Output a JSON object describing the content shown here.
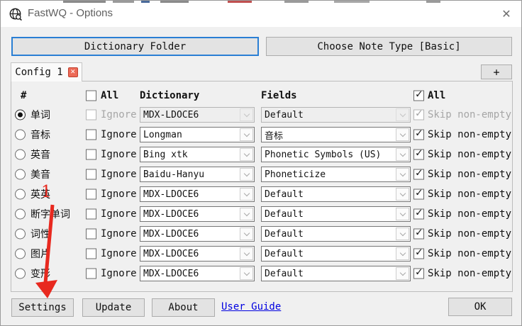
{
  "window": {
    "title": "FastWQ - Options",
    "close_glyph": "✕"
  },
  "toolbar": {
    "dictionary_folder": "Dictionary Folder",
    "choose_note_type": "Choose Note Type [Basic]"
  },
  "tabs": {
    "active_label": "Config 1",
    "close_glyph": "✕",
    "add_label": "+"
  },
  "table": {
    "headers": {
      "number": "#",
      "all_left": "All",
      "dictionary": "Dictionary",
      "fields": "Fields",
      "all_right": "All"
    },
    "ignore_label": "Ignore",
    "skip_label": "Skip non-empty",
    "rows": [
      {
        "label": "单词",
        "selected": true,
        "disabled": true,
        "dictionary": "MDX-LDOCE6",
        "field": "Default",
        "skip_checked": true
      },
      {
        "label": "音标",
        "selected": false,
        "disabled": false,
        "dictionary": "Longman",
        "field": "音标",
        "skip_checked": true
      },
      {
        "label": "英音",
        "selected": false,
        "disabled": false,
        "dictionary": "Bing xtk",
        "field": "Phonetic Symbols (US)",
        "skip_checked": true
      },
      {
        "label": "美音",
        "selected": false,
        "disabled": false,
        "dictionary": "Baidu-Hanyu",
        "field": "Phoneticize",
        "skip_checked": true
      },
      {
        "label": "英英",
        "selected": false,
        "disabled": false,
        "dictionary": "MDX-LDOCE6",
        "field": "Default",
        "skip_checked": true
      },
      {
        "label": "断字单词",
        "selected": false,
        "disabled": false,
        "dictionary": "MDX-LDOCE6",
        "field": "Default",
        "skip_checked": true
      },
      {
        "label": "词性",
        "selected": false,
        "disabled": false,
        "dictionary": "MDX-LDOCE6",
        "field": "Default",
        "skip_checked": true
      },
      {
        "label": "图片",
        "selected": false,
        "disabled": false,
        "dictionary": "MDX-LDOCE6",
        "field": "Default",
        "skip_checked": true
      },
      {
        "label": "变形",
        "selected": false,
        "disabled": false,
        "dictionary": "MDX-LDOCE6",
        "field": "Default",
        "skip_checked": true
      }
    ]
  },
  "footer": {
    "settings": "Settings",
    "update": "Update",
    "about": "About",
    "user_guide": "User Guide",
    "ok": "OK"
  },
  "annotation": {
    "step_number": "1"
  },
  "colors": {
    "accent_blue": "#2a7fd4",
    "annotation_red": "#e8291f",
    "link_blue": "#0000e0",
    "tab_close_red": "#ec6a57"
  }
}
